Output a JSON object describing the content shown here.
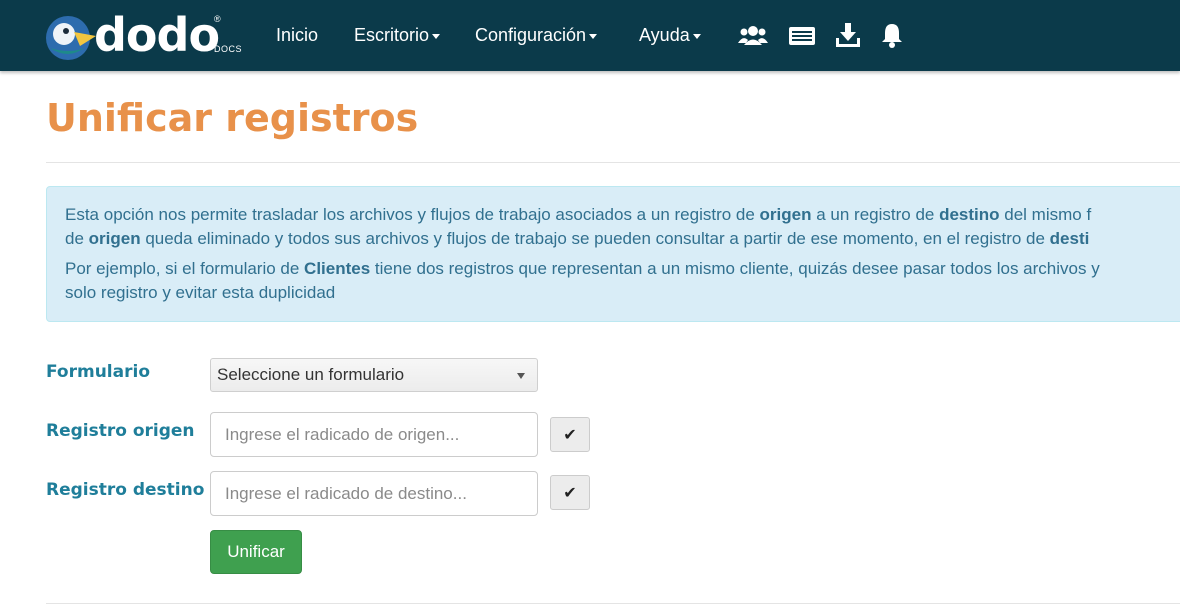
{
  "app": {
    "logo_text": "dodo",
    "logo_sub": "DOCS",
    "logo_reg": "®"
  },
  "nav": {
    "items": [
      {
        "label": "Inicio",
        "dropdown": false
      },
      {
        "label": "Escritorio",
        "dropdown": true
      },
      {
        "label": "Configuración",
        "dropdown": true
      },
      {
        "label": "Ayuda",
        "dropdown": true
      }
    ],
    "icons": [
      "users-icon",
      "id-card-icon",
      "download-icon",
      "bell-icon"
    ]
  },
  "page": {
    "title": "Unificar registros"
  },
  "info": {
    "p1_a": "Esta opción nos permite trasladar los archivos y flujos de trabajo asociados a un registro de ",
    "p1_b": "origen",
    "p1_c": " a un registro de ",
    "p1_d": "destino",
    "p1_e": " del mismo f",
    "p2_a": "de ",
    "p2_b": "origen",
    "p2_c": " queda eliminado y todos sus archivos y flujos de trabajo se pueden consultar a partir de ese momento, en el registro de ",
    "p2_d": "desti",
    "p3_a": "Por ejemplo, si el formulario de ",
    "p3_b": "Clientes",
    "p3_c": " tiene dos registros que representan a un mismo cliente, quizás desee pasar todos los archivos y",
    "p4": "solo registro y evitar esta duplicidad"
  },
  "form": {
    "formulario_label": "Formulario",
    "formulario_value": "Seleccione un formulario",
    "origen_label": "Registro origen",
    "origen_placeholder": "Ingrese el radicado de origen...",
    "destino_label": "Registro destino",
    "destino_placeholder": "Ingrese el radicado de destino...",
    "check_glyph": "✔",
    "submit_label": "Unificar"
  },
  "colors": {
    "navbar": "#0b3a4a",
    "title": "#e8914a",
    "label": "#1f7e9a",
    "info_bg": "#d9edf7",
    "submit": "#3fa04f"
  }
}
